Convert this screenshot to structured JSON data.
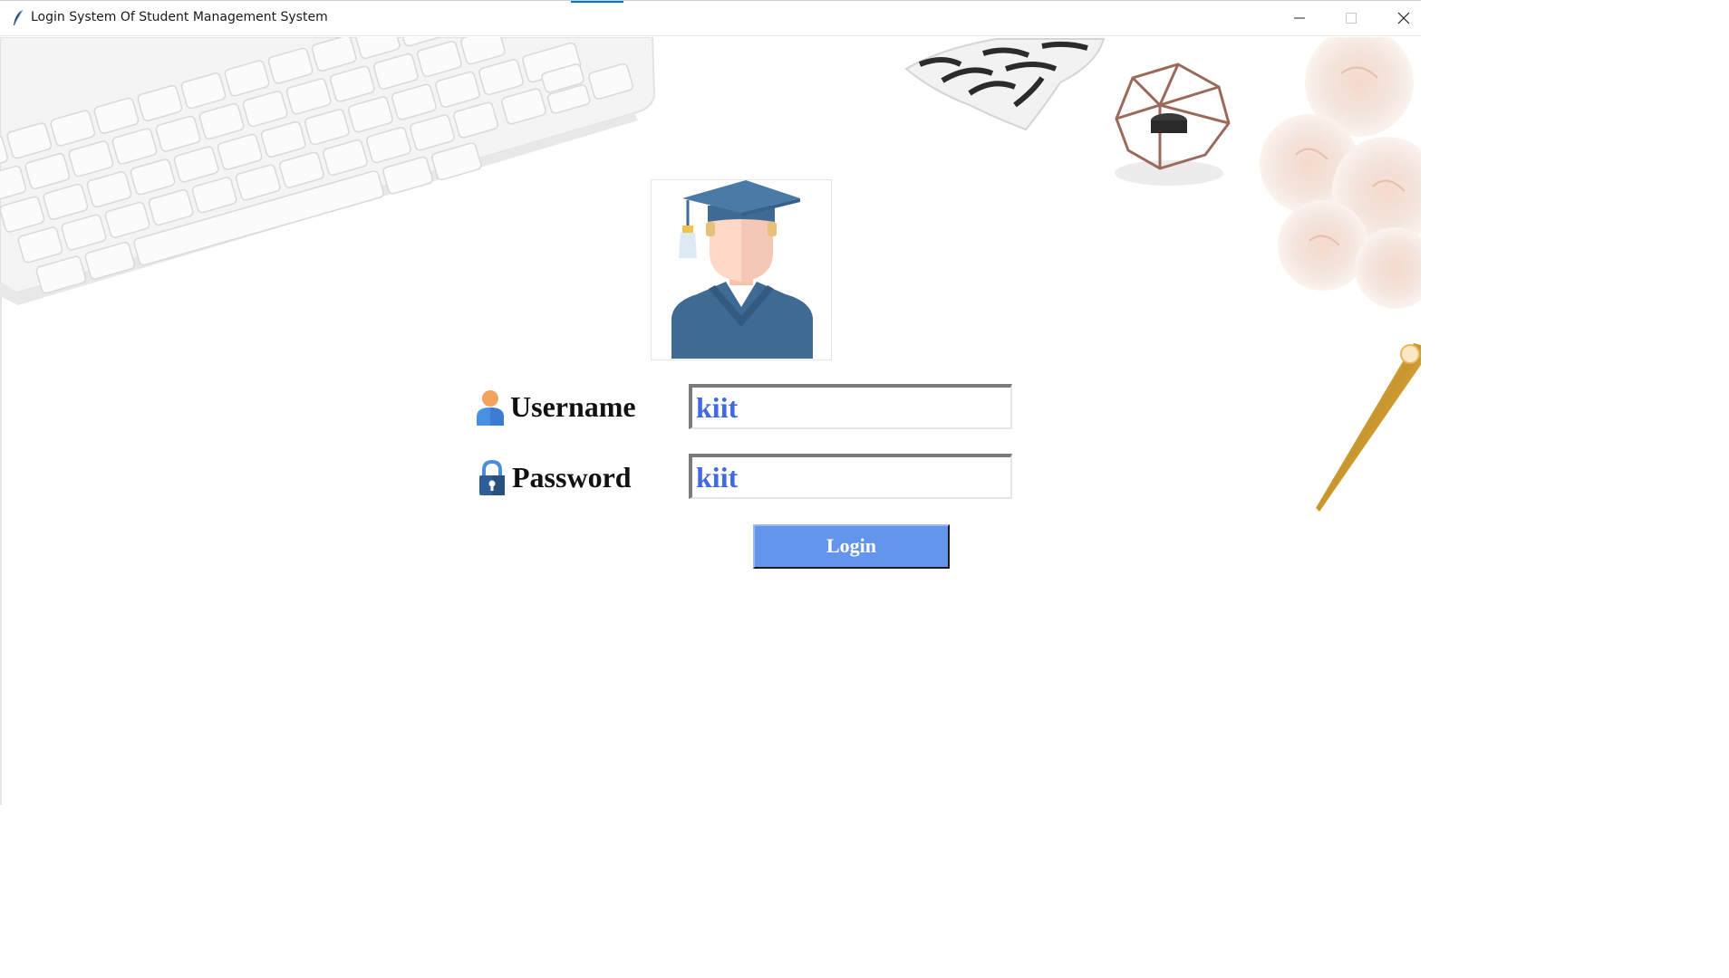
{
  "window": {
    "title": "Login System Of Student Management System",
    "app_icon": "feather-icon",
    "controls": [
      "minimize-icon",
      "maximize-icon",
      "close-icon"
    ]
  },
  "background": {
    "objects": [
      "keyboard",
      "zebra-tray",
      "geometric-candle-holder",
      "roses",
      "gold-pen"
    ]
  },
  "login": {
    "avatar": "student-graduate-icon",
    "username": {
      "label": "Username",
      "icon": "user-icon",
      "value": "kiit"
    },
    "password": {
      "label": "Password",
      "icon": "lock-icon",
      "value": "kiit"
    },
    "button_label": "Login"
  },
  "colors": {
    "button": "#6495ed",
    "field_text": "#4169e1",
    "label_text": "#111111",
    "avatar_gown": "#3f6a94"
  }
}
